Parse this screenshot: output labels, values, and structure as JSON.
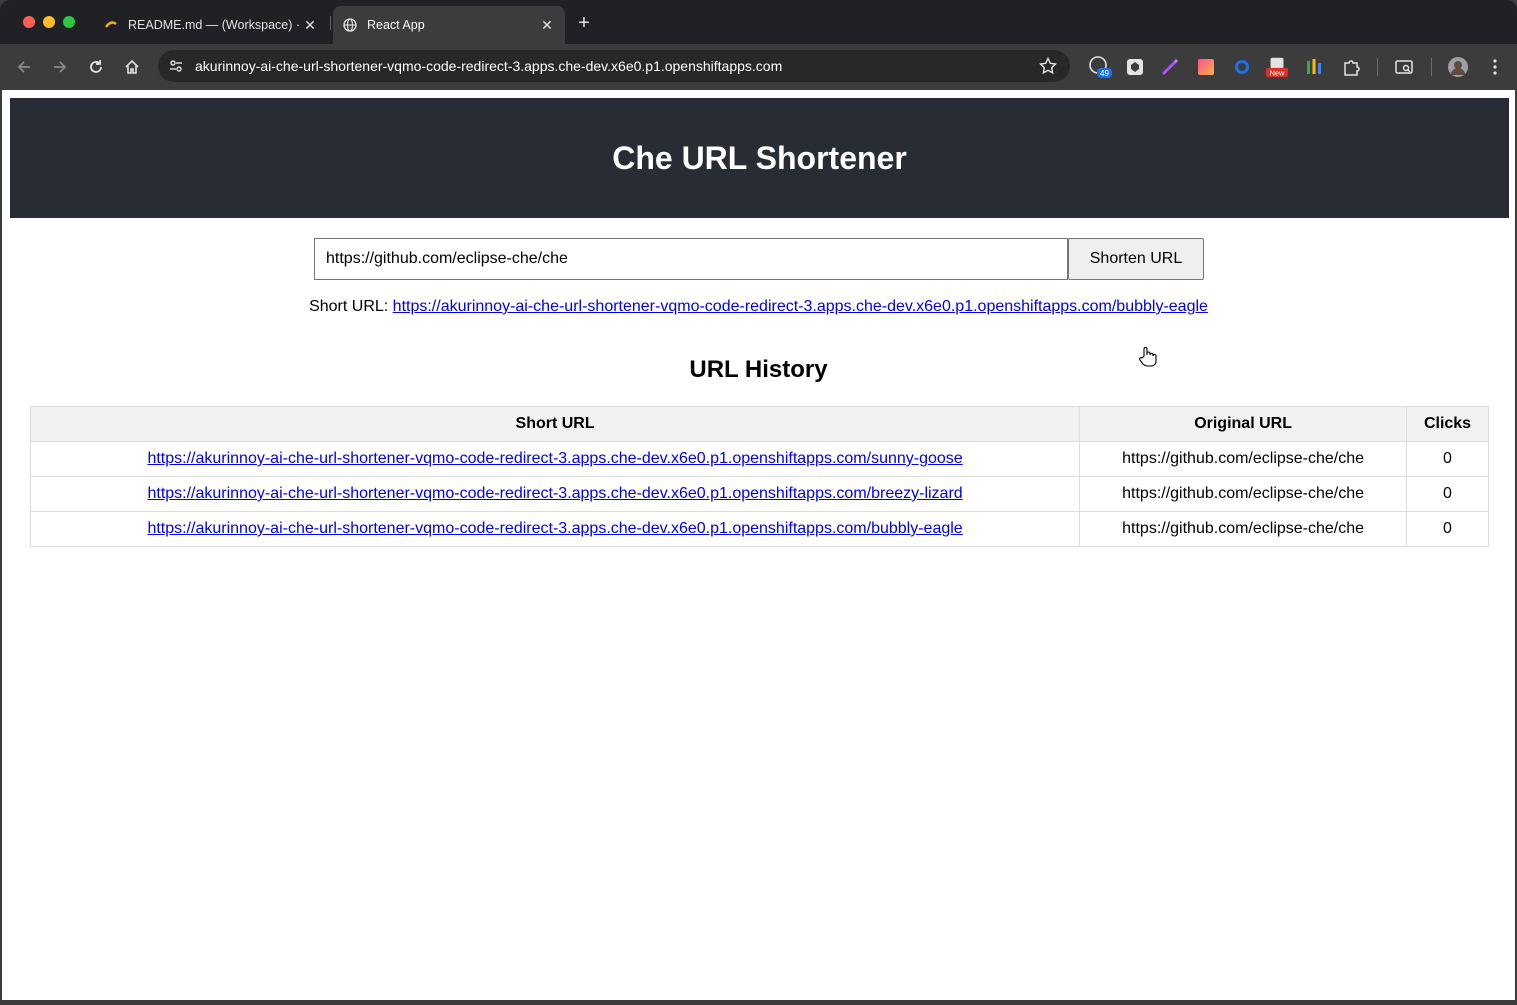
{
  "browser": {
    "tabs": [
      {
        "title": "README.md — (Workspace) ·",
        "active": false
      },
      {
        "title": "React App",
        "active": true
      }
    ],
    "address": "akurinnoy-ai-che-url-shortener-vqmo-code-redirect-3.apps.che-dev.x6e0.p1.openshiftapps.com",
    "extension_badges": {
      "count_badge": "49",
      "new_badge": "New"
    }
  },
  "app": {
    "title": "Che URL Shortener",
    "input_value": "https://github.com/eclipse-che/che",
    "button_label": "Shorten URL",
    "short_url_label": "Short URL:",
    "short_url": "https://akurinnoy-ai-che-url-shortener-vqmo-code-redirect-3.apps.che-dev.x6e0.p1.openshiftapps.com/bubbly-eagle"
  },
  "history": {
    "title": "URL History",
    "columns": [
      "Short URL",
      "Original URL",
      "Clicks"
    ],
    "rows": [
      {
        "short": "https://akurinnoy-ai-che-url-shortener-vqmo-code-redirect-3.apps.che-dev.x6e0.p1.openshiftapps.com/sunny-goose",
        "original": "https://github.com/eclipse-che/che",
        "clicks": "0"
      },
      {
        "short": "https://akurinnoy-ai-che-url-shortener-vqmo-code-redirect-3.apps.che-dev.x6e0.p1.openshiftapps.com/breezy-lizard",
        "original": "https://github.com/eclipse-che/che",
        "clicks": "0"
      },
      {
        "short": "https://akurinnoy-ai-che-url-shortener-vqmo-code-redirect-3.apps.che-dev.x6e0.p1.openshiftapps.com/bubbly-eagle",
        "original": "https://github.com/eclipse-che/che",
        "clicks": "0"
      }
    ]
  },
  "colors": {
    "header_bg": "#282c34",
    "link": "#0000ee",
    "tab_strip": "#202124",
    "toolbar": "#3c3c3c"
  }
}
